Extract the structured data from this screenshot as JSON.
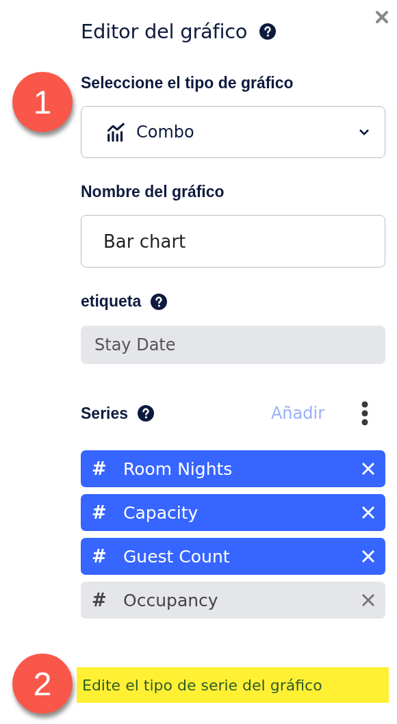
{
  "panel": {
    "title": "Editor del gráfico"
  },
  "chart_type": {
    "label": "Seleccione el tipo de gráfico",
    "value": "Combo"
  },
  "chart_name": {
    "label": "Nombre del gráfico",
    "value": "Bar chart"
  },
  "tag": {
    "label": "etiqueta",
    "value": "Stay Date"
  },
  "series": {
    "label": "Series",
    "add": "Añadir",
    "items": [
      {
        "symbol": "#",
        "name": "Room Nights",
        "selected": true
      },
      {
        "symbol": "#",
        "name": "Capacity",
        "selected": true
      },
      {
        "symbol": "#",
        "name": "Guest Count",
        "selected": true
      },
      {
        "symbol": "#",
        "name": "Occupancy",
        "selected": false
      }
    ]
  },
  "annotations": [
    {
      "number": "1"
    },
    {
      "number": "2",
      "note": "Edite el tipo de serie del gráfico"
    }
  ]
}
